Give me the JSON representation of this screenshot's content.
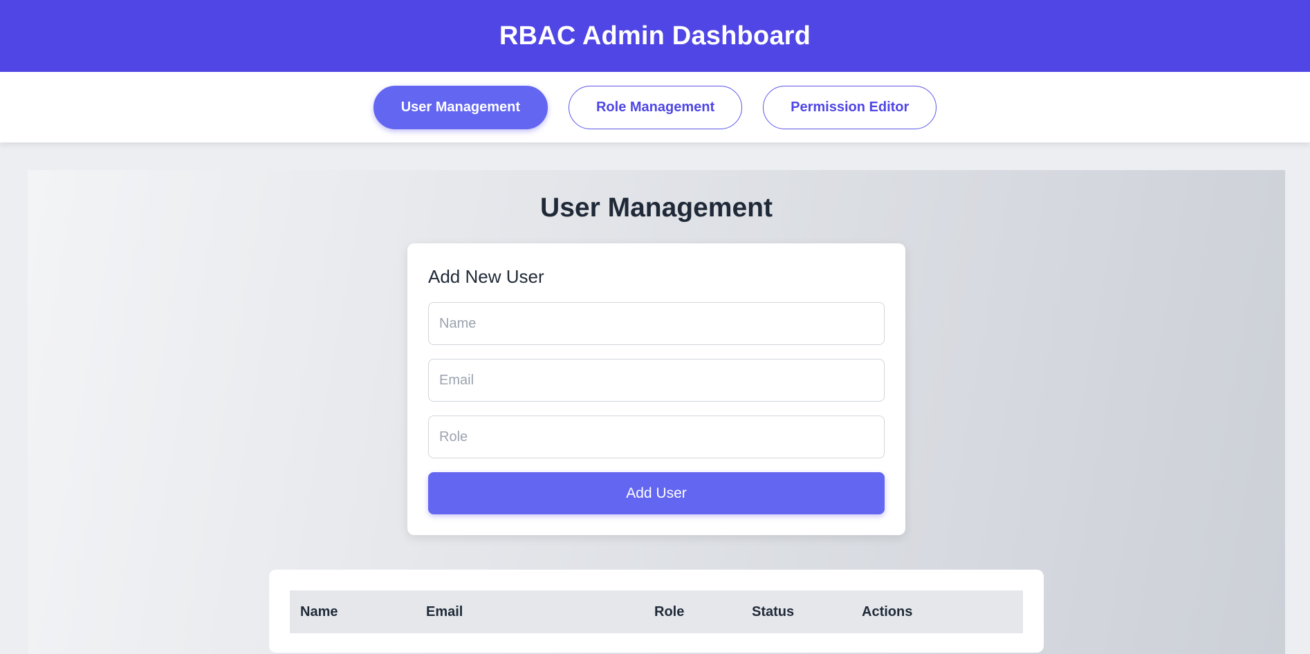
{
  "header": {
    "title": "RBAC Admin Dashboard"
  },
  "nav": {
    "tabs": [
      {
        "label": "User Management",
        "active": true
      },
      {
        "label": "Role Management",
        "active": false
      },
      {
        "label": "Permission Editor",
        "active": false
      }
    ]
  },
  "main": {
    "title": "User Management",
    "form": {
      "heading": "Add New User",
      "name_placeholder": "Name",
      "email_placeholder": "Email",
      "role_placeholder": "Role",
      "name_value": "",
      "email_value": "",
      "role_value": "",
      "submit_label": "Add User"
    },
    "table": {
      "columns": [
        "Name",
        "Email",
        "Role",
        "Status",
        "Actions"
      ]
    }
  },
  "colors": {
    "header_bg": "#5046e5",
    "accent": "#6366f1"
  }
}
